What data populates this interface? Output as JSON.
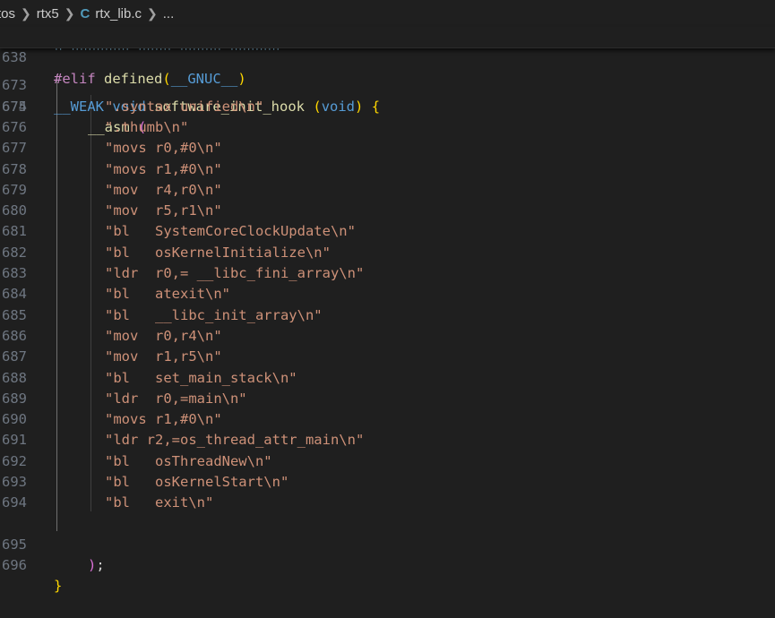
{
  "breadcrumb": {
    "items": [
      "rtos",
      "rtx5"
    ],
    "file_icon": "C",
    "file_name": "rtx_lib.c",
    "ellipsis": "..."
  },
  "sticky_line": {
    "number": "638",
    "directive": "#elif",
    "func": "defined",
    "open_paren": "(",
    "macro": "__GNUC__",
    "close_paren": ")"
  },
  "function_header": {
    "number": "673",
    "macro": "__WEAK",
    "type": "void",
    "name": "software_init_hook",
    "open_paren": "(",
    "param": "void",
    "close_paren": ")",
    "brace": "{"
  },
  "asm_open": {
    "number": "674",
    "keyword": "__asm",
    "paren": "("
  },
  "asm_lines": [
    {
      "number": "675",
      "text": "\".syntax unified\\n\""
    },
    {
      "number": "676",
      "text": "\".thumb\\n\""
    },
    {
      "number": "677",
      "text": "\"movs r0,#0\\n\""
    },
    {
      "number": "678",
      "text": "\"movs r1,#0\\n\""
    },
    {
      "number": "679",
      "text": "\"mov  r4,r0\\n\""
    },
    {
      "number": "680",
      "text": "\"mov  r5,r1\\n\""
    },
    {
      "number": "681",
      "text": "\"bl   SystemCoreClockUpdate\\n\""
    },
    {
      "number": "682",
      "text": "\"bl   osKernelInitialize\\n\""
    },
    {
      "number": "683",
      "text": "\"ldr  r0,= __libc_fini_array\\n\""
    },
    {
      "number": "684",
      "text": "\"bl   atexit\\n\""
    },
    {
      "number": "685",
      "text": "\"bl   __libc_init_array\\n\""
    },
    {
      "number": "686",
      "text": "\"mov  r0,r4\\n\""
    },
    {
      "number": "687",
      "text": "\"mov  r1,r5\\n\""
    },
    {
      "number": "688",
      "text": "\"bl   set_main_stack\\n\""
    },
    {
      "number": "689",
      "text": "\"ldr  r0,=main\\n\""
    },
    {
      "number": "690",
      "text": "\"movs r1,#0\\n\""
    },
    {
      "number": "691",
      "text": "\"ldr r2,=os_thread_attr_main\\n\""
    },
    {
      "number": "692",
      "text": "\"bl   osThreadNew\\n\""
    },
    {
      "number": "693",
      "text": "\"bl   osKernelStart\\n\""
    },
    {
      "number": "694",
      "text": "\"bl   exit\\n\""
    }
  ],
  "asm_close": {
    "number": "695",
    "paren": ")",
    "semicolon": ";"
  },
  "function_close": {
    "number": "696",
    "brace": "}"
  },
  "colors": {
    "background": "#1f1f1f",
    "line_number": "#6e7681",
    "string": "#ce9178",
    "keyword": "#569cd6",
    "function": "#dcdcaa",
    "directive": "#c586c0",
    "bracket_level1": "#ffd700",
    "bracket_level2": "#da70d6"
  }
}
